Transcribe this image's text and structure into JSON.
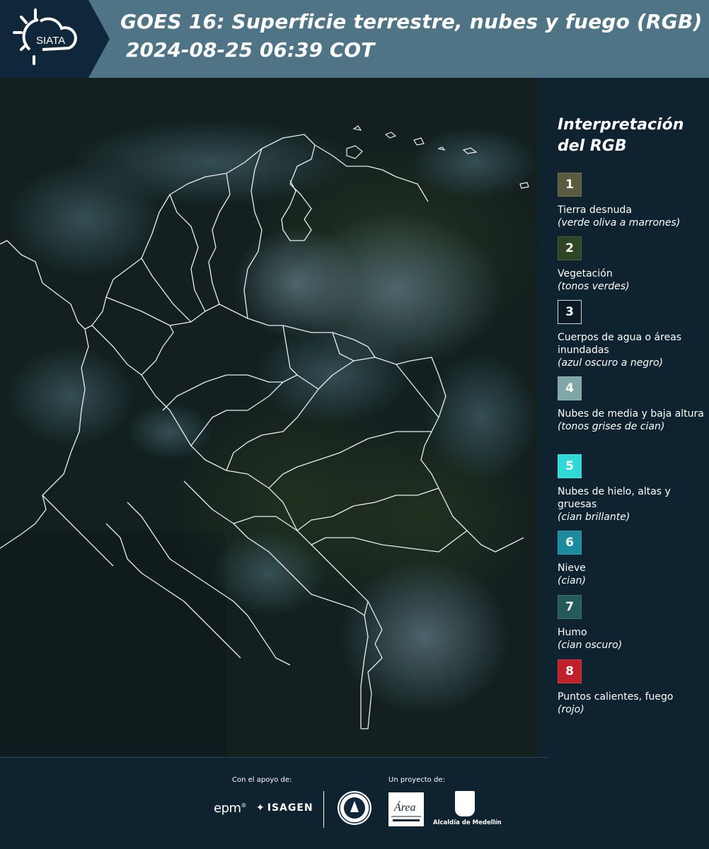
{
  "header": {
    "logo_text": "SIATA",
    "title_line1": "GOES 16: Superficie terrestre, nubes y fuego (RGB)",
    "title_line2": "2024-08-25 06:39 COT"
  },
  "legend": {
    "title_line1": "Interpretación",
    "title_line2": "del RGB",
    "items": [
      {
        "number": "1",
        "label": "Tierra desnuda",
        "sub": "(verde oliva a marrones)",
        "color": "#5b5b40"
      },
      {
        "number": "2",
        "label": "Vegetación",
        "sub": "(tonos verdes)",
        "color": "#2f4626"
      },
      {
        "number": "3",
        "label": "Cuerpos de agua o áreas inundadas",
        "sub": "(azul oscuro a negro)",
        "color": "#0d1a24"
      },
      {
        "number": "4",
        "label": "Nubes de media y baja altura",
        "sub": "(tonos grises de cian)",
        "color": "#7fa7a7"
      },
      {
        "number": "5",
        "label": "Nubes de hielo, altas y gruesas",
        "sub": "(cian brillante)",
        "color": "#30d8d8"
      },
      {
        "number": "6",
        "label": "Nieve",
        "sub": "(cian)",
        "color": "#1c8ba0"
      },
      {
        "number": "7",
        "label": "Humo",
        "sub": "(cian oscuro)",
        "color": "#245a5a"
      },
      {
        "number": "8",
        "label": "Puntos calientes, fuego",
        "sub": "(rojo)",
        "color": "#c0202a"
      }
    ]
  },
  "footer": {
    "support_label": "Con el apoyo de:",
    "project_label": "Un proyecto de:",
    "epm": "epm",
    "isagen": "ISAGEN",
    "area_text": "Área",
    "alcaldia": "Alcaldía de Medellín"
  }
}
